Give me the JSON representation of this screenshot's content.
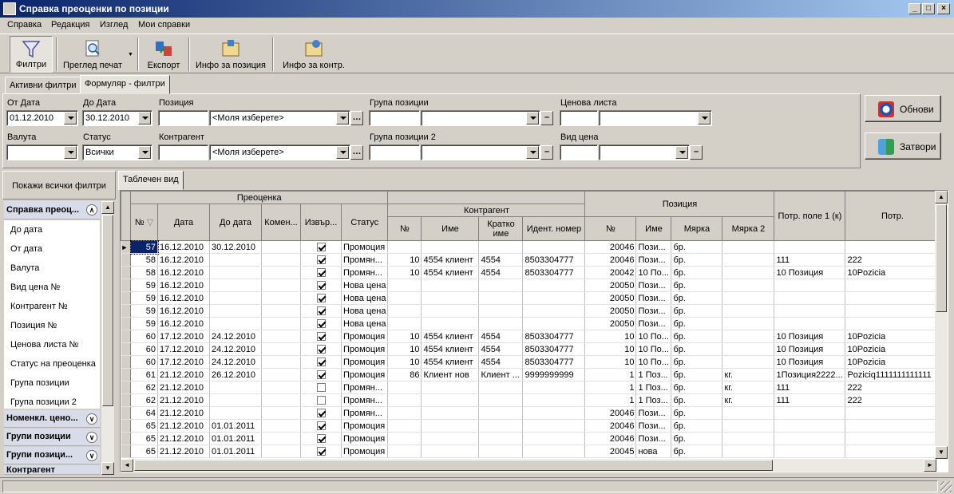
{
  "window": {
    "title": "Справка преоценки по позиции"
  },
  "menu": [
    "Справка",
    "Редакция",
    "Изглед",
    "Мои справки"
  ],
  "toolbar": {
    "filters": "Филтри",
    "print_preview": "Преглед печат",
    "export": "Експорт",
    "item_info": "Инфо за позиция",
    "contr_info": "Инфо за контр."
  },
  "tabs": {
    "active_filters": "Активни филтри",
    "form_filters": "Формуляр - филтри"
  },
  "filters": {
    "from_date_label": "От Дата",
    "from_date": "01.12.2010",
    "to_date_label": "До Дата",
    "to_date": "30.12.2010",
    "position_label": "Позиция",
    "position_placeholder": "<Моля изберете>",
    "group_label": "Група позиции",
    "price_list_label": "Ценова листа",
    "currency_label": "Валута",
    "status_label": "Статус",
    "status": "Всички",
    "contragent_label": "Контрагент",
    "contragent_placeholder": "<Моля изберете>",
    "group2_label": "Група позиции 2",
    "price_type_label": "Вид цена"
  },
  "buttons": {
    "refresh": "Обнови",
    "close": "Затвори"
  },
  "sidebar": {
    "show_all": "Покажи всички филтри",
    "group_active": "Справка преоц...",
    "items": [
      "До дата",
      "От дата",
      "Валута",
      "Вид цена №",
      "Контрагент №",
      "Позиция №",
      "Ценова листа №",
      "Статус на преоценка",
      "Група позиции",
      "Група позиции 2"
    ],
    "groups": [
      "Номенкл. цено...",
      "Групи позиции",
      "Групи позици...",
      "Контрагент"
    ]
  },
  "grid": {
    "tab": "Таблечен вид",
    "bands": {
      "revaluation": "Преоценка",
      "contragent": "Контрагент",
      "position": "Позиция",
      "extra1": "Потр. поле 1 (к)",
      "extra2": "Потр."
    },
    "headers": {
      "no": "№",
      "date": "Дата",
      "to_date": "До дата",
      "comment": "Комен...",
      "done": "Извър...",
      "status": "Статус",
      "c_no": "№",
      "c_name": "Име",
      "c_short": "Кратко име",
      "c_ident": "Идент. номер",
      "p_no": "№",
      "p_name": "Име",
      "p_unit": "Мярка",
      "p_unit2": "Мярка 2"
    },
    "rows": [
      {
        "no": "57",
        "date": "16.12.2010",
        "to": "30.12.2010",
        "chk": true,
        "status": "Промоция",
        "cno": "",
        "cname": "",
        "cshort": "",
        "cid": "",
        "pno": "20046",
        "pname": "Пози...",
        "unit": "бр.",
        "unit2": "",
        "e1": "",
        "e2": ""
      },
      {
        "no": "58",
        "date": "16.12.2010",
        "to": "",
        "chk": true,
        "status": "Промян...",
        "cno": "10",
        "cname": "4554 клиент",
        "cshort": "4554",
        "cid": "8503304777",
        "pno": "20046",
        "pname": "Пози...",
        "unit": "бр.",
        "unit2": "",
        "e1": "111",
        "e2": "222"
      },
      {
        "no": "58",
        "date": "16.12.2010",
        "to": "",
        "chk": true,
        "status": "Промян...",
        "cno": "10",
        "cname": "4554 клиент",
        "cshort": "4554",
        "cid": "8503304777",
        "pno": "20042",
        "pname": "10 По...",
        "unit": "бр.",
        "unit2": "",
        "e1": "10 Позиция",
        "e2": "10Pozicia"
      },
      {
        "no": "59",
        "date": "16.12.2010",
        "to": "",
        "chk": true,
        "status": "Нова цена",
        "cno": "",
        "cname": "",
        "cshort": "",
        "cid": "",
        "pno": "20050",
        "pname": "Пози...",
        "unit": "бр.",
        "unit2": "",
        "e1": "",
        "e2": ""
      },
      {
        "no": "59",
        "date": "16.12.2010",
        "to": "",
        "chk": true,
        "status": "Нова цена",
        "cno": "",
        "cname": "",
        "cshort": "",
        "cid": "",
        "pno": "20050",
        "pname": "Пози...",
        "unit": "бр.",
        "unit2": "",
        "e1": "",
        "e2": ""
      },
      {
        "no": "59",
        "date": "16.12.2010",
        "to": "",
        "chk": true,
        "status": "Нова цена",
        "cno": "",
        "cname": "",
        "cshort": "",
        "cid": "",
        "pno": "20050",
        "pname": "Пози...",
        "unit": "бр.",
        "unit2": "",
        "e1": "",
        "e2": ""
      },
      {
        "no": "59",
        "date": "16.12.2010",
        "to": "",
        "chk": true,
        "status": "Нова цена",
        "cno": "",
        "cname": "",
        "cshort": "",
        "cid": "",
        "pno": "20050",
        "pname": "Пози...",
        "unit": "бр.",
        "unit2": "",
        "e1": "",
        "e2": ""
      },
      {
        "no": "60",
        "date": "17.12.2010",
        "to": "24.12.2010",
        "chk": true,
        "status": "Промоция",
        "cno": "10",
        "cname": "4554 клиент",
        "cshort": "4554",
        "cid": "8503304777",
        "pno": "10",
        "pname": "10 По...",
        "unit": "бр.",
        "unit2": "",
        "e1": "10 Позиция",
        "e2": "10Pozicia"
      },
      {
        "no": "60",
        "date": "17.12.2010",
        "to": "24.12.2010",
        "chk": true,
        "status": "Промоция",
        "cno": "10",
        "cname": "4554 клиент",
        "cshort": "4554",
        "cid": "8503304777",
        "pno": "10",
        "pname": "10 По...",
        "unit": "бр.",
        "unit2": "",
        "e1": "10 Позиция",
        "e2": "10Pozicia"
      },
      {
        "no": "60",
        "date": "17.12.2010",
        "to": "24.12.2010",
        "chk": true,
        "status": "Промоция",
        "cno": "10",
        "cname": "4554 клиент",
        "cshort": "4554",
        "cid": "8503304777",
        "pno": "10",
        "pname": "10 По...",
        "unit": "бр.",
        "unit2": "",
        "e1": "10 Позиция",
        "e2": "10Pozicia"
      },
      {
        "no": "61",
        "date": "21.12.2010",
        "to": "26.12.2010",
        "chk": true,
        "status": "Промоция",
        "cno": "86",
        "cname": "Клиент нов",
        "cshort": "Клиент ...",
        "cid": "9999999999",
        "pno": "1",
        "pname": "1 Поз...",
        "unit": "бр.",
        "unit2": "кг.",
        "e1": "1Позиция2222...",
        "e2": "Poziciq1111111111111"
      },
      {
        "no": "62",
        "date": "21.12.2010",
        "to": "",
        "chk": false,
        "status": "Промян...",
        "cno": "",
        "cname": "",
        "cshort": "",
        "cid": "",
        "pno": "1",
        "pname": "1 Поз...",
        "unit": "бр.",
        "unit2": "кг.",
        "e1": "111",
        "e2": "222"
      },
      {
        "no": "62",
        "date": "21.12.2010",
        "to": "",
        "chk": false,
        "status": "Промян...",
        "cno": "",
        "cname": "",
        "cshort": "",
        "cid": "",
        "pno": "1",
        "pname": "1 Поз...",
        "unit": "бр.",
        "unit2": "кг.",
        "e1": "111",
        "e2": "222"
      },
      {
        "no": "64",
        "date": "21.12.2010",
        "to": "",
        "chk": true,
        "status": "Промян...",
        "cno": "",
        "cname": "",
        "cshort": "",
        "cid": "",
        "pno": "20046",
        "pname": "Пози...",
        "unit": "бр.",
        "unit2": "",
        "e1": "",
        "e2": ""
      },
      {
        "no": "65",
        "date": "21.12.2010",
        "to": "01.01.2011",
        "chk": true,
        "status": "Промоция",
        "cno": "",
        "cname": "",
        "cshort": "",
        "cid": "",
        "pno": "20046",
        "pname": "Пози...",
        "unit": "бр.",
        "unit2": "",
        "e1": "",
        "e2": ""
      },
      {
        "no": "65",
        "date": "21.12.2010",
        "to": "01.01.2011",
        "chk": true,
        "status": "Промоция",
        "cno": "",
        "cname": "",
        "cshort": "",
        "cid": "",
        "pno": "20046",
        "pname": "Пози...",
        "unit": "бр.",
        "unit2": "",
        "e1": "",
        "e2": ""
      },
      {
        "no": "65",
        "date": "21.12.2010",
        "to": "01.01.2011",
        "chk": true,
        "status": "Промоция",
        "cno": "",
        "cname": "",
        "cshort": "",
        "cid": "",
        "pno": "20045",
        "pname": "нова",
        "unit": "бр.",
        "unit2": "",
        "e1": "",
        "e2": ""
      }
    ]
  }
}
